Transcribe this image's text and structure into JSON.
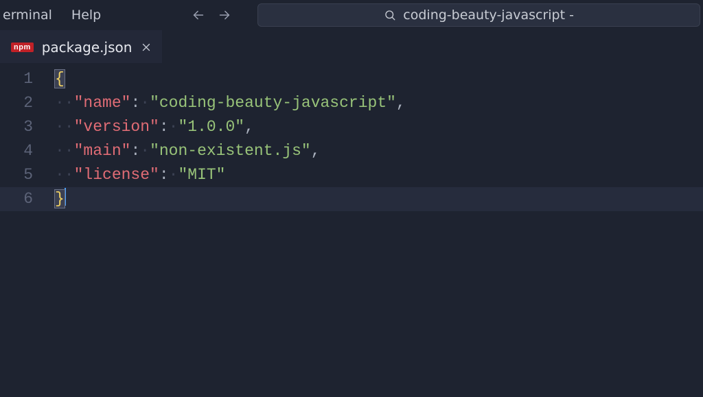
{
  "menu": {
    "terminal": "erminal",
    "help": "Help"
  },
  "search": {
    "text": "coding-beauty-javascript -"
  },
  "tab": {
    "badge": "npm",
    "title": "package.json"
  },
  "lines": {
    "l1": "1",
    "l2": "2",
    "l3": "3",
    "l4": "4",
    "l5": "5",
    "l6": "6"
  },
  "code": {
    "brace_open": "{",
    "brace_close": "}",
    "k_name": "\"name\"",
    "v_name": "\"coding-beauty-javascript\"",
    "k_version": "\"version\"",
    "v_version": "\"1.0.0\"",
    "k_main": "\"main\"",
    "v_main": "\"non-existent.js\"",
    "k_license": "\"license\"",
    "v_license": "\"MIT\"",
    "colon": ":",
    "comma": ",",
    "indent": "··"
  }
}
